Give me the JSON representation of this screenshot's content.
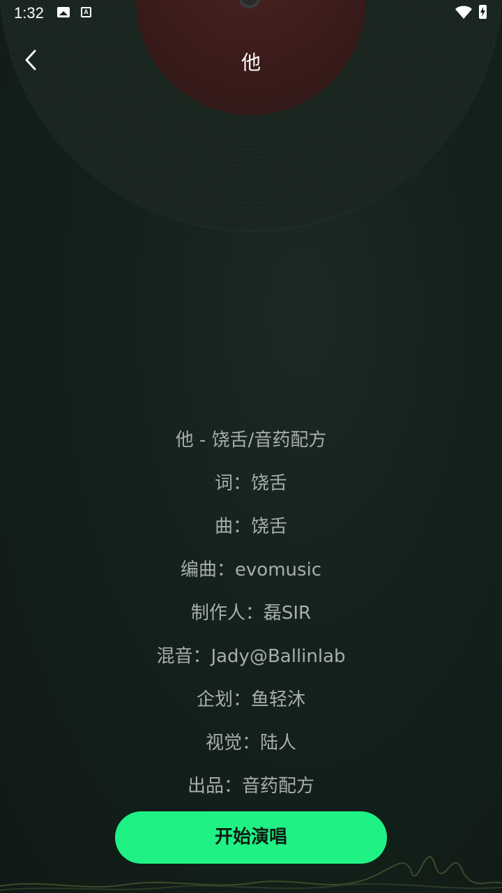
{
  "status_bar": {
    "time": "1:32",
    "icons": [
      "image-icon",
      "font-a-icon",
      "wifi-icon",
      "battery-charging-icon"
    ]
  },
  "header": {
    "title": "他",
    "back_icon": "chevron-left-icon"
  },
  "credits": [
    "他 - 饶舌/音药配方",
    "词：饶舌",
    "曲：饶舌",
    "编曲：evomusic",
    "制作人：磊SIR",
    "混音：Jady@Ballinlab",
    "企划：鱼轻沐",
    "视觉：陆人",
    "出品：音药配方"
  ],
  "start_button": {
    "label": "开始演唱"
  },
  "colors": {
    "accent": "#1ff184",
    "background": "#132019",
    "text_muted": "#a8aeab"
  }
}
